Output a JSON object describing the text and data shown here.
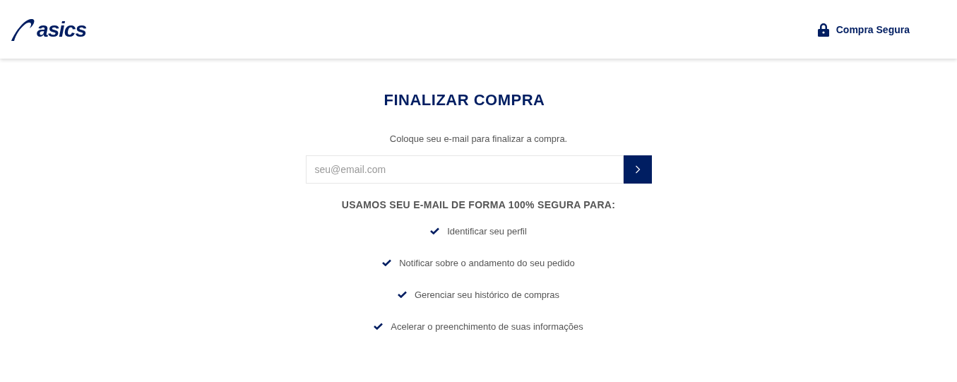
{
  "header": {
    "logo": "asics",
    "secure_label": "Compra Segura"
  },
  "title": "FINALIZAR COMPRA",
  "subtitle": "Coloque seu e-mail para finalizar a compra.",
  "email_field": {
    "placeholder": "seu@email.com"
  },
  "benefits_heading": "USAMOS SEU E-MAIL DE FORMA 100% SEGURA PARA:",
  "benefits": [
    {
      "label": "Identificar seu perfil"
    },
    {
      "label": "Notificar sobre o andamento do seu pedido"
    },
    {
      "label": "Gerenciar seu histórico de compras"
    },
    {
      "label": "Acelerar o preenchimento de suas informações"
    }
  ]
}
